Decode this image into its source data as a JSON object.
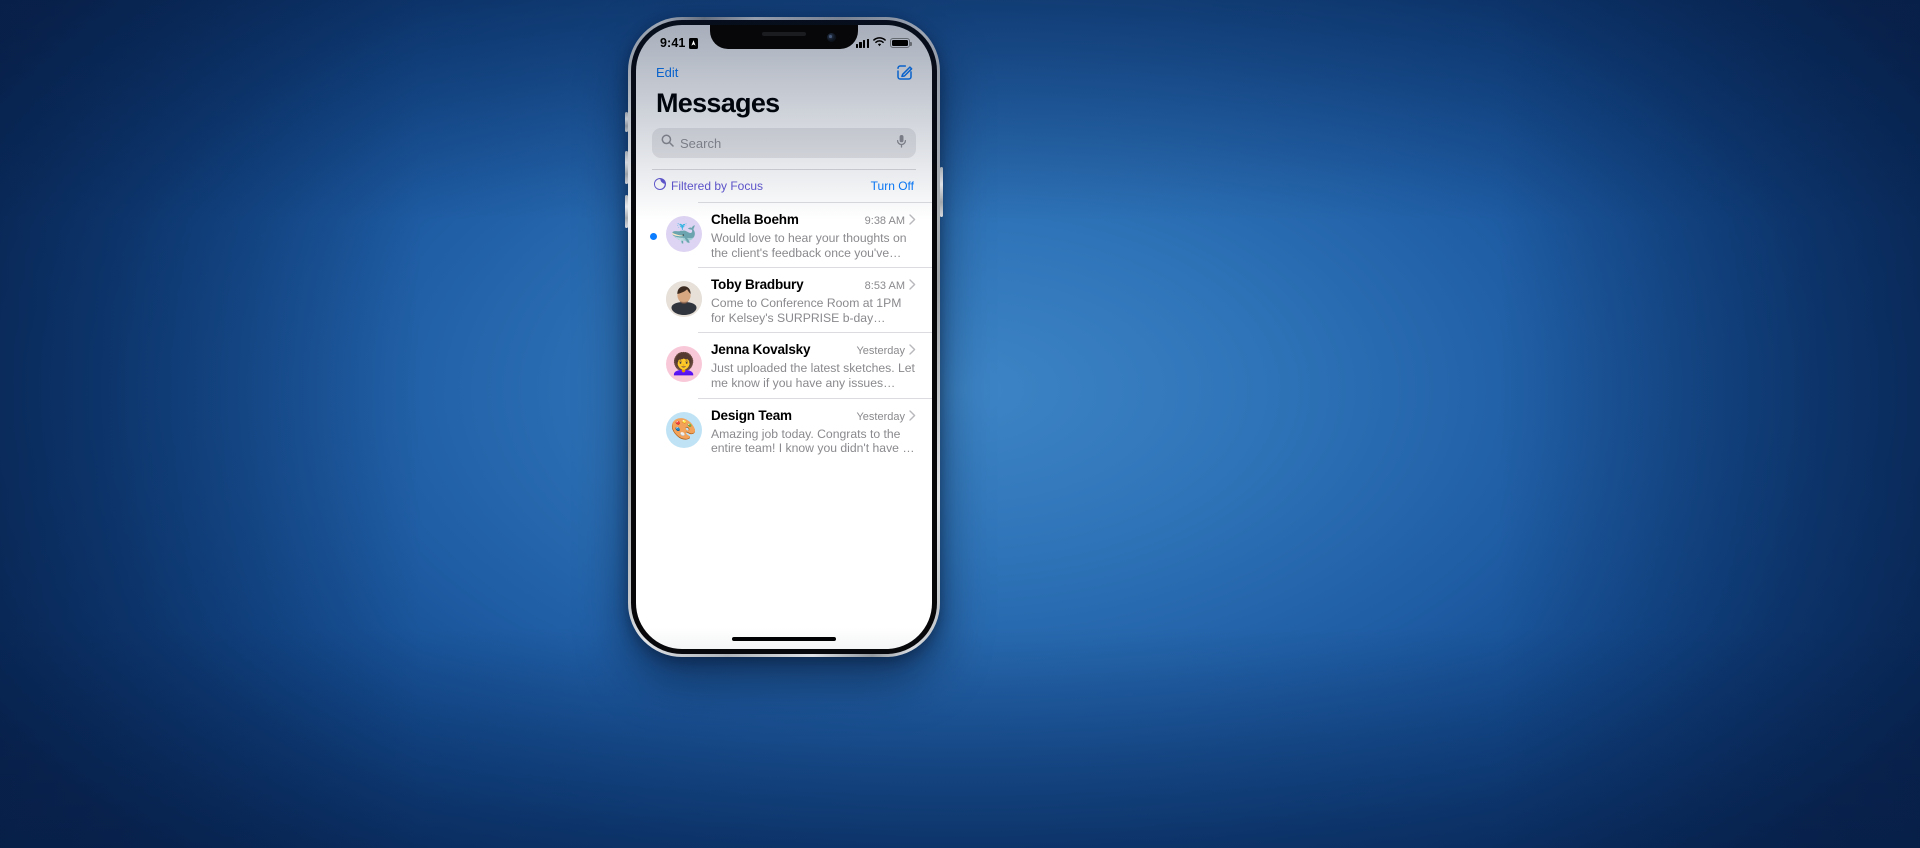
{
  "wallpaper": {
    "color_center": "#3d85c6",
    "color_edge": "#0a2f66"
  },
  "device": {
    "frame_color": "#cfd2d4"
  },
  "status_bar": {
    "time": "9:41",
    "location_icon": "location-services-icon",
    "cellular_icon": "cellular-bars-icon",
    "wifi_icon": "wifi-icon",
    "battery_icon": "battery-full-icon"
  },
  "nav": {
    "edit_label": "Edit",
    "compose_icon": "compose-icon",
    "accent": "#0a7cff"
  },
  "header": {
    "title": "Messages"
  },
  "search": {
    "placeholder": "Search",
    "value": "",
    "search_icon": "search-icon",
    "dictation_icon": "microphone-icon"
  },
  "focus": {
    "icon": "focus-moon-icon",
    "label": "Filtered by Focus",
    "action_label": "Turn Off",
    "label_color": "#6257d2",
    "action_color": "#0a7cff"
  },
  "conversations": [
    {
      "name": "Chella Boehm",
      "time": "9:38 AM",
      "preview": "Would love to hear your thoughts on the client's feedback once you've finished th…",
      "unread": true,
      "avatar": {
        "type": "memoji",
        "glyph": "🐳",
        "bg": "#ddd3f2"
      }
    },
    {
      "name": "Toby Bradbury",
      "time": "8:53 AM",
      "preview": "Come to Conference Room at 1PM for Kelsey's SURPRISE b-day celebration.",
      "unread": false,
      "avatar": {
        "type": "photo",
        "glyph": "",
        "bg": "#ded7d0"
      }
    },
    {
      "name": "Jenna Kovalsky",
      "time": "Yesterday",
      "preview": "Just uploaded the latest sketches. Let me know if you have any issues accessing.",
      "unread": false,
      "avatar": {
        "type": "memoji",
        "glyph": "👩‍🦱",
        "bg": "#f9c8d8"
      }
    },
    {
      "name": "Design Team",
      "time": "Yesterday",
      "preview": "Amazing job today. Congrats to the entire team! I know you didn't have a lot of tim…",
      "unread": false,
      "avatar": {
        "type": "emoji",
        "glyph": "🎨",
        "bg": "#bfe3f5"
      }
    }
  ],
  "home_indicator": "home-indicator"
}
